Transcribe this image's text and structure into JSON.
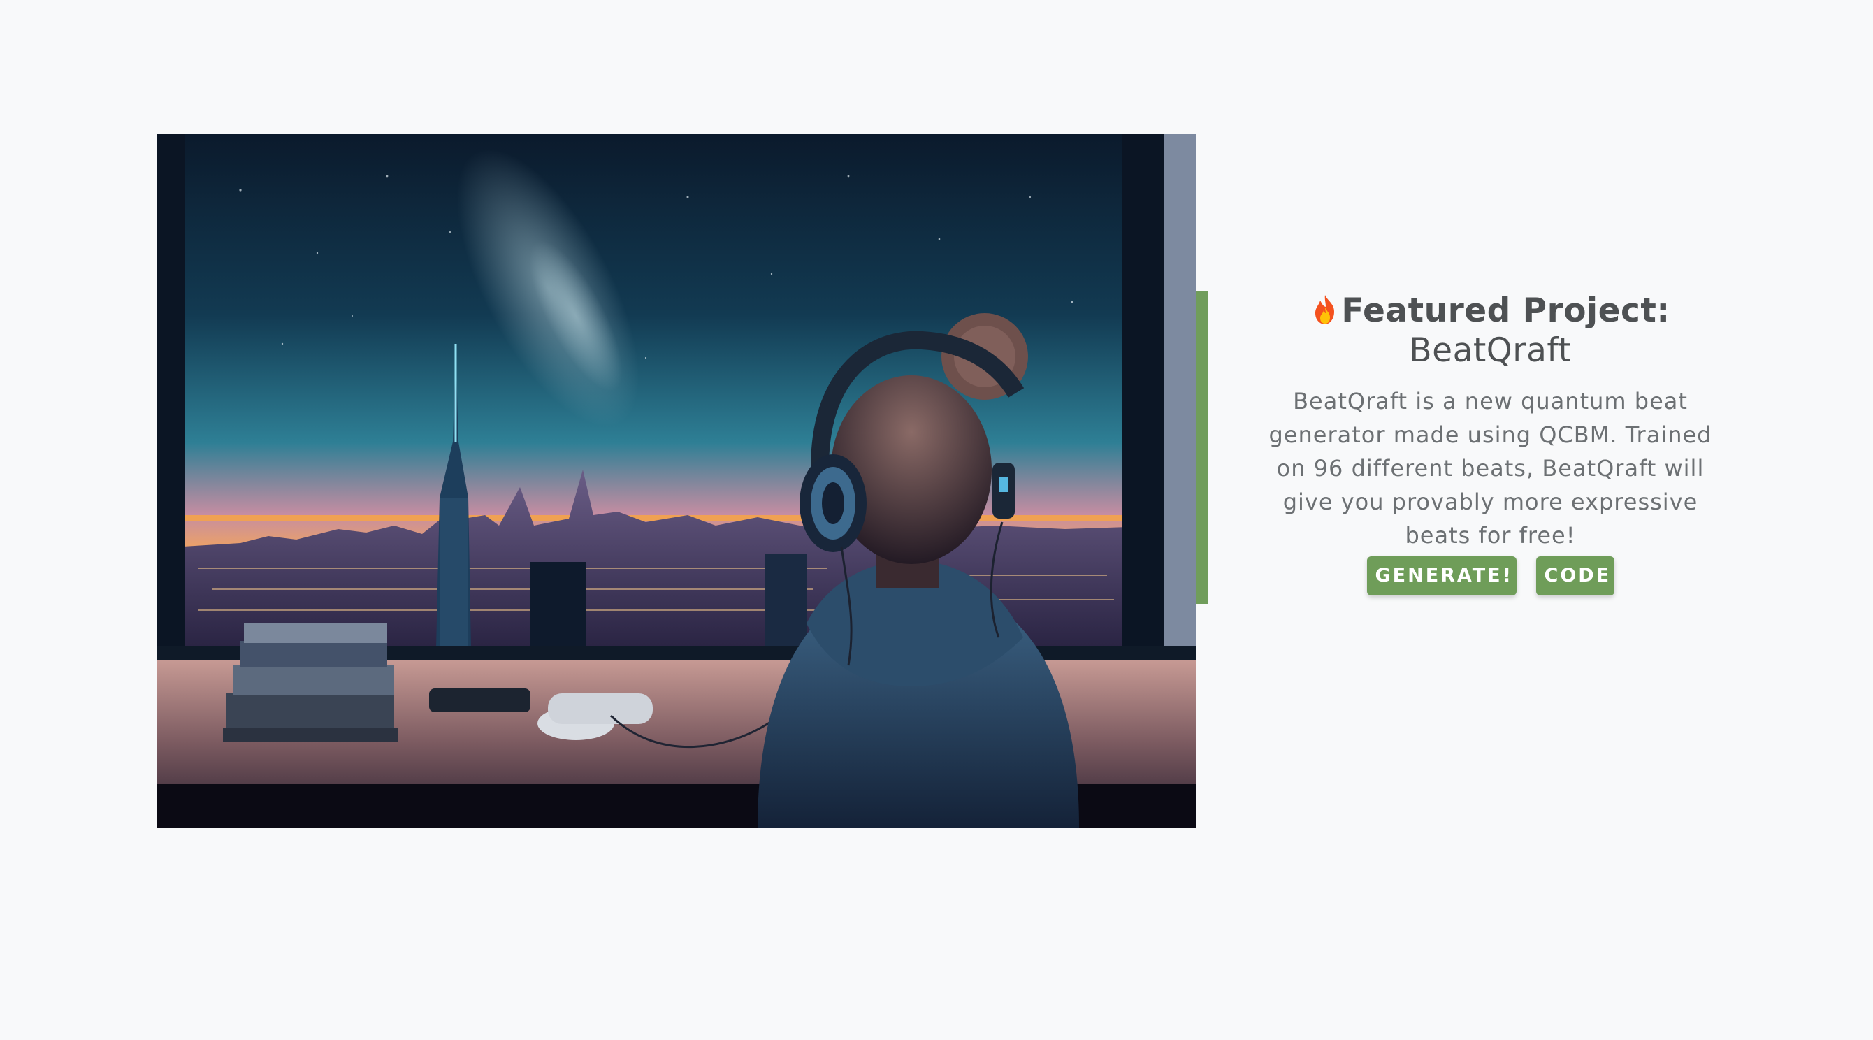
{
  "featured": {
    "icon": "fire-icon",
    "title_label": "Featured Project:",
    "project_name": "BeatQraft",
    "description": "BeatQraft is a new quantum beat generator made using QCBM. Trained on 96 different beats, BeatQraft will give you provably more expressive beats for free!",
    "buttons": {
      "generate_label": "GENERATE!",
      "code_label": "CODE"
    }
  },
  "image": {
    "subject": "person-with-headphones-city-night-window"
  },
  "colors": {
    "accent": "#709d5b",
    "button": "#6f9d59",
    "title_text": "#4e5153",
    "body_text": "#6c7073",
    "background": "#f8f9fa"
  }
}
